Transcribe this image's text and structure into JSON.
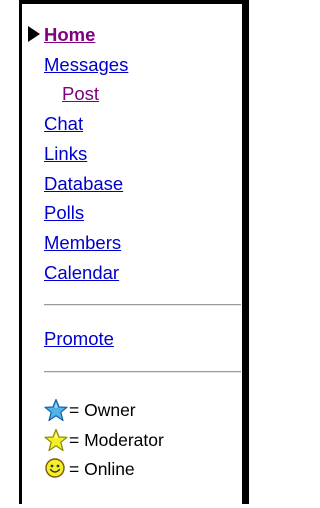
{
  "nav": {
    "items": [
      {
        "label": "Home"
      },
      {
        "label": "Messages"
      },
      {
        "label": "Post"
      },
      {
        "label": "Chat"
      },
      {
        "label": "Links"
      },
      {
        "label": "Database"
      },
      {
        "label": "Polls"
      },
      {
        "label": "Members"
      },
      {
        "label": "Calendar"
      }
    ],
    "promote": "Promote"
  },
  "legend": {
    "owner": "= Owner",
    "moderator": "= Moderator",
    "online": "= Online"
  },
  "colors": {
    "link": "#0000cc",
    "visited": "#800080",
    "owner_star": "#4fb3e8",
    "moderator_star": "#f5ef2a",
    "online_face": "#f5ef2a"
  },
  "icons": {
    "current_pointer": "current-page-pointer-icon",
    "owner": "blue-star-icon",
    "moderator": "yellow-star-icon",
    "online": "smiley-face-icon"
  }
}
